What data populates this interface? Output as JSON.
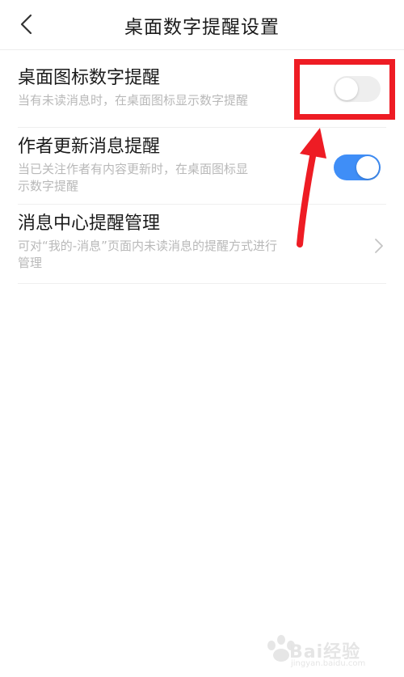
{
  "header": {
    "title": "桌面数字提醒设置",
    "back_icon": "chevron-left-icon"
  },
  "settings": [
    {
      "title": "桌面图标数字提醒",
      "description": "当有未读消息时，在桌面图标显示数字提醒",
      "control": "toggle",
      "enabled": false
    },
    {
      "title": "作者更新消息提醒",
      "description_line1": "当已关注作者有内容更新时，在桌面图标显",
      "description_line2": "示数字提醒",
      "control": "toggle",
      "enabled": true
    },
    {
      "title": "消息中心提醒管理",
      "description_line1": "可对“我的-消息”页面内未读消息的提醒方式进行",
      "description_line2": "管理",
      "control": "chevron-right-icon"
    }
  ],
  "annotation": {
    "box_color": "#ee1c24",
    "arrow_color": "#ee1c24"
  },
  "watermark": {
    "text": "Bai经验",
    "url": "jingyan.baidu.com"
  },
  "colors": {
    "toggle_on": "#3f8ef7",
    "toggle_off": "#eeeeee",
    "description_text": "#b9b9b9"
  }
}
